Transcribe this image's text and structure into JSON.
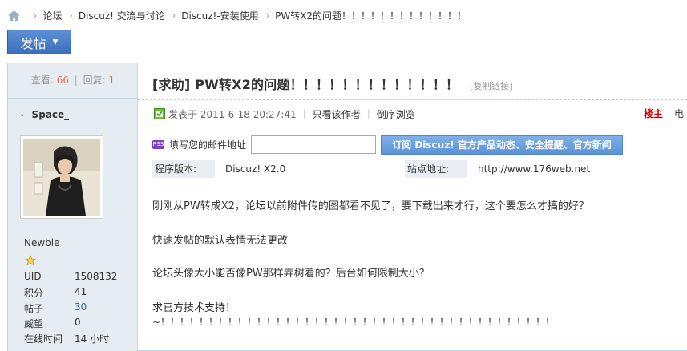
{
  "breadcrumb": {
    "items": [
      "论坛",
      "Discuz! 交流与讨论",
      "Discuz!-安装使用"
    ],
    "current": "PW转X2的问题！！！！！！！！！！！！！"
  },
  "post_button": {
    "label": "发帖"
  },
  "stats": {
    "views_label": "查看:",
    "views": "66",
    "divider": "|",
    "replies_label": "回复:",
    "replies": "1"
  },
  "author": {
    "name": "Space_",
    "rank": "Newbie",
    "profile": [
      {
        "key": "UID",
        "value": "1508132"
      },
      {
        "key": "积分",
        "value": "41"
      },
      {
        "key": "帖子",
        "value": "30"
      },
      {
        "key": "威望",
        "value": "0"
      },
      {
        "key": "在线时间",
        "value": "14 小时"
      }
    ]
  },
  "thread": {
    "title": "[求助] PW转X2的问题！！！！！！！！！！！！！",
    "copy_link": "[复制链接]"
  },
  "post_meta": {
    "posted_label": "发表于 2011-6-18 20:27:41",
    "only_author": "只看该作者",
    "reverse": "倒序浏览",
    "floor": "楼主",
    "floor_extra": "电"
  },
  "subscribe": {
    "badge": "RSS",
    "label": "填写您的邮件地址",
    "email_value": "",
    "button": "订阅 Discuz! 官方产品动态、安全提醒、官方新闻"
  },
  "info": {
    "version_label": "程序版本:",
    "version_value": "Discuz! X2.0",
    "site_label": "站点地址:",
    "site_value": "http://www.176web.net"
  },
  "content": {
    "lines": [
      "刚刚从PW转成X2，论坛以前附件传的图都看不见了，要下载出来才行，这个要怎么才搞的好？",
      "快速发帖的默认表情无法更改",
      "论坛头像大小能否像PW那样弄树着的？后台如何限制大小？",
      "求官方技术支持！",
      "~！！！！！！！！！！！！！！！！！！！！！！！！！！！！！！！！！！！！！！！！！"
    ]
  },
  "colors": {
    "accent_blue": "#3a6fbd",
    "count_red": "#f26c4f",
    "floor_red": "#cc0000",
    "panel_bg": "#e5edf2"
  }
}
